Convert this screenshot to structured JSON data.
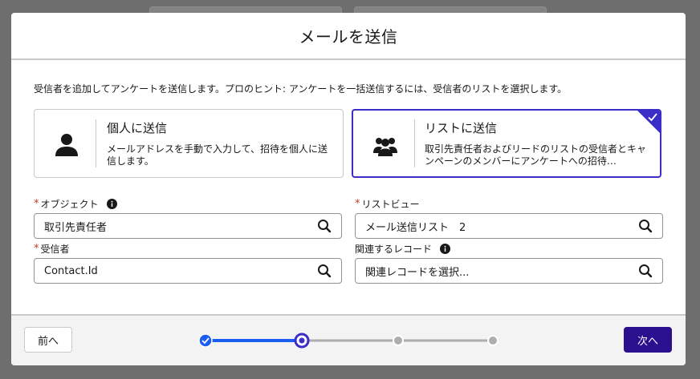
{
  "modal": {
    "title": "メールを送信",
    "hint": "受信者を追加してアンケートを送信します。プロのヒント: アンケートを一括送信するには、受信者のリストを選択します。"
  },
  "options": [
    {
      "title": "個人に送信",
      "description": "メールアドレスを手動で入力して、招待を個人に送信します。",
      "icon": "user-icon",
      "selected": false
    },
    {
      "title": "リストに送信",
      "description": "取引先責任者およびリードのリストの受信者とキャンペーンのメンバーにアンケートへの招待…",
      "icon": "group-icon",
      "selected": true
    }
  ],
  "fields": {
    "object": {
      "label": "オブジェクト",
      "required": true,
      "value": "取引先責任者",
      "has_info": true
    },
    "list_view": {
      "label": "リストビュー",
      "required": true,
      "value": "メール送信リスト　2"
    },
    "recipient": {
      "label": "受信者",
      "required": true,
      "value": "Contact.Id"
    },
    "related_record": {
      "label": "関連するレコード",
      "required": false,
      "placeholder": "関連レコードを選択...",
      "has_info": true
    }
  },
  "footer": {
    "prev_label": "前へ",
    "next_label": "次へ",
    "progress": {
      "total_steps": 4,
      "current_step": 2,
      "completed_steps": 1
    }
  },
  "colors": {
    "brand": "#3a2ec7",
    "progress_active": "#1b5cf3",
    "next_button": "#2a0f8f",
    "required": "#c23934"
  }
}
